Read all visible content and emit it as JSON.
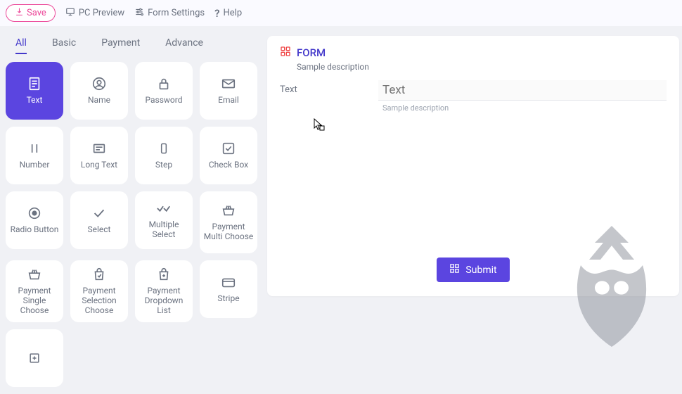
{
  "toolbar": {
    "save": "Save",
    "preview": "PC Preview",
    "settings": "Form Settings",
    "help": "Help"
  },
  "tabs": [
    {
      "id": "all",
      "label": "All",
      "active": true
    },
    {
      "id": "basic",
      "label": "Basic"
    },
    {
      "id": "payment",
      "label": "Payment"
    },
    {
      "id": "advance",
      "label": "Advance"
    }
  ],
  "tiles": [
    {
      "icon": "text",
      "label": "Text",
      "active": true
    },
    {
      "icon": "name",
      "label": "Name"
    },
    {
      "icon": "password",
      "label": "Password"
    },
    {
      "icon": "email",
      "label": "Email"
    },
    {
      "icon": "number",
      "label": "Number"
    },
    {
      "icon": "longtext",
      "label": "Long Text"
    },
    {
      "icon": "step",
      "label": "Step"
    },
    {
      "icon": "checkbox",
      "label": "Check Box"
    },
    {
      "icon": "radio",
      "label": "Radio Button"
    },
    {
      "icon": "select",
      "label": "Select"
    },
    {
      "icon": "multiselect",
      "label": "Multiple Select"
    },
    {
      "icon": "basket",
      "label": "Payment Multi Choose"
    },
    {
      "icon": "basket",
      "label": "Payment Single Choose"
    },
    {
      "icon": "bag",
      "label": "Payment Selection Choose"
    },
    {
      "icon": "bagplus",
      "label": "Payment Dropdown List"
    },
    {
      "icon": "card",
      "label": "Stripe"
    },
    {
      "icon": "plus",
      "label": ""
    }
  ],
  "form": {
    "title": "FORM",
    "description": "Sample description",
    "field": {
      "label": "Text",
      "placeholder": "Text",
      "sub": "Sample description"
    },
    "submit": "Submit"
  }
}
